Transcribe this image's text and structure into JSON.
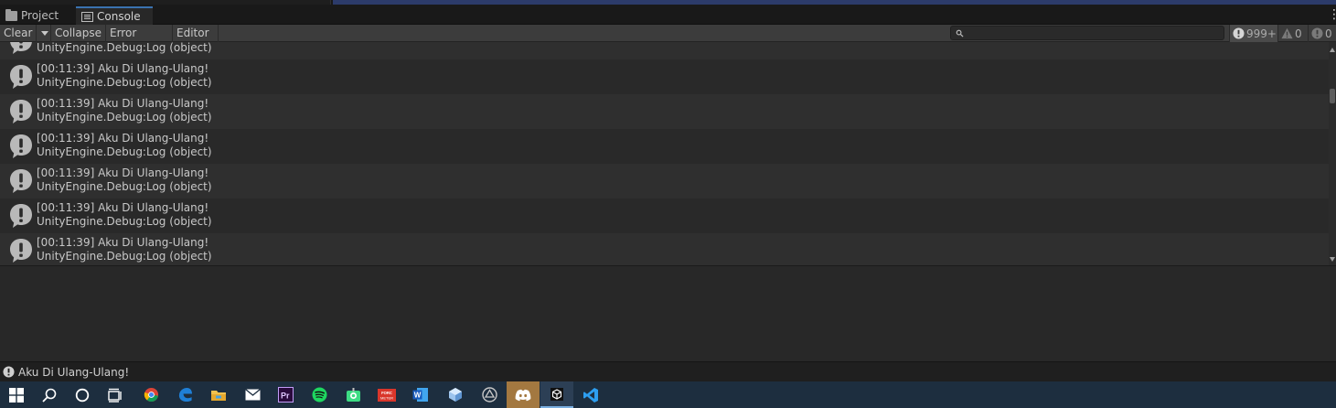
{
  "tabs": [
    {
      "label": "Project",
      "icon": "folder-icon"
    },
    {
      "label": "Console",
      "icon": "console-icon"
    }
  ],
  "toolbar": {
    "clear_label": "Clear",
    "collapse_label": "Collapse",
    "error_pause_label": "Error Pause",
    "editor_label": "Editor",
    "search_placeholder": "",
    "search_value": "",
    "log_count": "999+",
    "warning_count": "0",
    "error_count": "0"
  },
  "log_entries": [
    {
      "line1": "",
      "line2": "UnityEngine.Debug:Log (object)"
    },
    {
      "line1": "[00:11:39] Aku Di Ulang-Ulang!",
      "line2": "UnityEngine.Debug:Log (object)"
    },
    {
      "line1": "[00:11:39] Aku Di Ulang-Ulang!",
      "line2": "UnityEngine.Debug:Log (object)"
    },
    {
      "line1": "[00:11:39] Aku Di Ulang-Ulang!",
      "line2": "UnityEngine.Debug:Log (object)"
    },
    {
      "line1": "[00:11:39] Aku Di Ulang-Ulang!",
      "line2": "UnityEngine.Debug:Log (object)"
    },
    {
      "line1": "[00:11:39] Aku Di Ulang-Ulang!",
      "line2": "UnityEngine.Debug:Log (object)"
    },
    {
      "line1": "[00:11:39] Aku Di Ulang-Ulang!",
      "line2": "UnityEngine.Debug:Log (object)"
    }
  ],
  "status_bar": {
    "message": "Aku Di Ulang-Ulang!"
  },
  "taskbar": {
    "items": [
      "windows-start",
      "search",
      "cortana",
      "task-view",
      "chrome",
      "edge",
      "file-explorer",
      "mail",
      "premiere-pro",
      "spotify",
      "android-studio",
      "cpu-app",
      "word",
      "3d-viewer",
      "unity-hub",
      "discord",
      "unity",
      "vscode"
    ],
    "pinned_labels": {
      "cpu_app": "FOREC METER"
    }
  },
  "colors": {
    "panel_bg": "#282828",
    "row_odd": "#2f2f2f",
    "row_even": "#292929",
    "toolbar_bg": "#3c3c3c",
    "tab_accent": "#3a72b0",
    "taskbar_bg": "#1d2e3f",
    "discord_active": "#a37840"
  }
}
